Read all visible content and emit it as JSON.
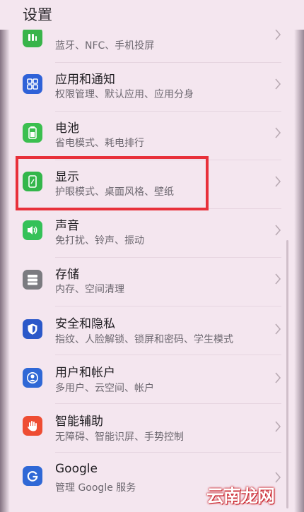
{
  "header": {
    "title": "设置"
  },
  "items": [
    {
      "key": "more-connections",
      "icon": "connection-icon",
      "icon_color": "#38b44a",
      "title": "",
      "subtitle": "蓝牙、NFC、手机投屏"
    },
    {
      "key": "apps",
      "icon": "apps-grid-icon",
      "icon_color": "#2f62d8",
      "title": "应用和通知",
      "subtitle": "权限管理、默认应用、应用分身"
    },
    {
      "key": "battery",
      "icon": "battery-icon",
      "icon_color": "#3bbf4f",
      "title": "电池",
      "subtitle": "省电模式、耗电排行"
    },
    {
      "key": "display",
      "icon": "display-phone-icon",
      "icon_color": "#33b64b",
      "title": "显示",
      "subtitle": "护眼模式、桌面风格、壁纸"
    },
    {
      "key": "sound",
      "icon": "speaker-icon",
      "icon_color": "#34c158",
      "title": "声音",
      "subtitle": "免打扰、铃声、振动"
    },
    {
      "key": "storage",
      "icon": "storage-icon",
      "icon_color": "#7b7b80",
      "title": "存储",
      "subtitle": "内存、空间清理"
    },
    {
      "key": "security",
      "icon": "shield-icon",
      "icon_color": "#2b58c9",
      "title": "安全和隐私",
      "subtitle": "指纹、人脸解锁、锁屏和密码、学生模式"
    },
    {
      "key": "accounts",
      "icon": "user-icon",
      "icon_color": "#2f68d6",
      "title": "用户和帐户",
      "subtitle": "多用户、云空间、帐户"
    },
    {
      "key": "assist",
      "icon": "hand-icon",
      "icon_color": "#ee4d33",
      "title": "智能辅助",
      "subtitle": "无障碍、智能识屏、手势控制"
    },
    {
      "key": "google",
      "icon": "google-g-icon",
      "icon_color": "#2f68d6",
      "title": "Google",
      "subtitle": "管理 Google 服务"
    }
  ],
  "watermark": "云南龙网"
}
